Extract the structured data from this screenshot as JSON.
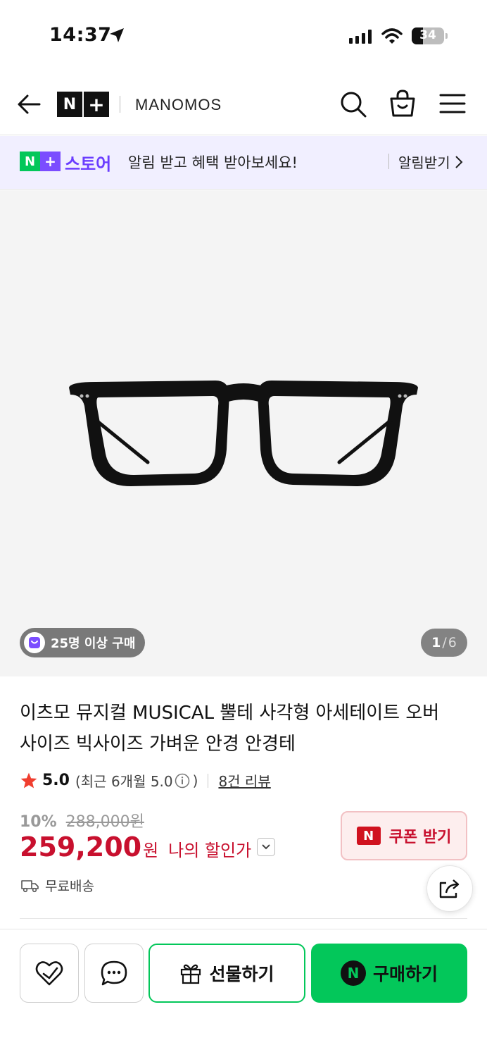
{
  "status_bar": {
    "time": "14:37",
    "battery": "34"
  },
  "header": {
    "logo_n": "N",
    "logo_plus": "+",
    "brand": "MANOMOS"
  },
  "notice": {
    "badge_n": "N",
    "badge_plus": "+",
    "store": "스토어",
    "message": "알림 받고 혜택 받아보세요!",
    "action": "알림받기"
  },
  "gallery": {
    "buyers_badge": "25명 이상 구매",
    "current": "1",
    "separator": "/",
    "total": "6"
  },
  "product": {
    "title": "이츠모 뮤지컬 MUSICAL 뿔테 사각형 아세테이트 오버사이즈 빅사이즈 가벼운 안경 안경테",
    "rating": "5.0",
    "recent_rating": "(최근 6개월 5.0",
    "recent_close": ")",
    "reviews": "8건 리뷰",
    "discount": "10%",
    "original_price": "288,000원",
    "price": "259,200",
    "currency": "원",
    "my_discount": "나의 할인가",
    "coupon_icon": "N",
    "coupon": "쿠폰 받기",
    "shipping": "무료배송"
  },
  "actions": {
    "gift": "선물하기",
    "buy_icon": "N",
    "buy": "구매하기"
  },
  "colors": {
    "naver_green": "#03c75a",
    "price_red": "#c8102e",
    "store_purple": "#6a3dff",
    "notice_bg": "#f1efff"
  },
  "icons": [
    "back-arrow-icon",
    "search-icon",
    "shopping-bag-icon",
    "hamburger-menu-icon",
    "chevron-right-icon",
    "shopping-bag-badge-icon",
    "star-icon",
    "info-icon",
    "chevron-down-icon",
    "truck-icon",
    "share-icon",
    "heart-check-icon",
    "chat-bubble-icon",
    "gift-icon"
  ]
}
